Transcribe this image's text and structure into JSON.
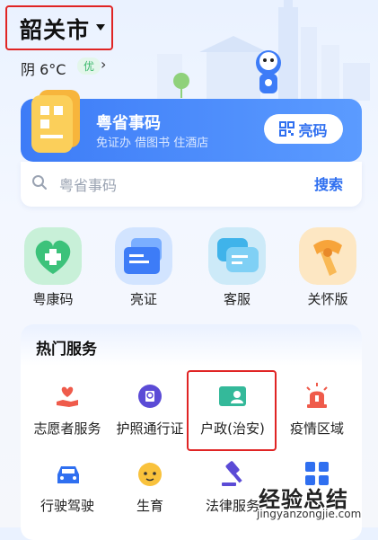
{
  "header": {
    "city": "韶关市",
    "weather": "阴 6°C",
    "aqi": "优"
  },
  "card": {
    "title": "粤省事码",
    "subtitle": "免证办 借图书 住酒店",
    "button": "亮码"
  },
  "search": {
    "placeholder": "粤省事码",
    "button": "搜索"
  },
  "quick": [
    {
      "label": "粤康码",
      "icon": "health-code-icon"
    },
    {
      "label": "亮证",
      "icon": "certificate-cards-icon"
    },
    {
      "label": "客服",
      "icon": "chat-bubble-icon"
    },
    {
      "label": "关怀版",
      "icon": "care-scarf-icon"
    }
  ],
  "services": {
    "title": "热门服务",
    "items": [
      {
        "label": "志愿者服务",
        "icon": "volunteer-hand-icon"
      },
      {
        "label": "护照通行证",
        "icon": "passport-globe-icon"
      },
      {
        "label": "户政(治安)",
        "icon": "household-id-icon"
      },
      {
        "label": "疫情区域",
        "icon": "alarm-siren-icon"
      },
      {
        "label": "行驶驾驶",
        "icon": "car-icon"
      },
      {
        "label": "生育",
        "icon": "baby-face-icon"
      },
      {
        "label": "法律服务",
        "icon": "gavel-icon"
      },
      {
        "label": "",
        "icon": "grid-apps-icon"
      }
    ]
  },
  "watermark": {
    "text": "经验总结",
    "url": "jingyanzongjie.com"
  }
}
